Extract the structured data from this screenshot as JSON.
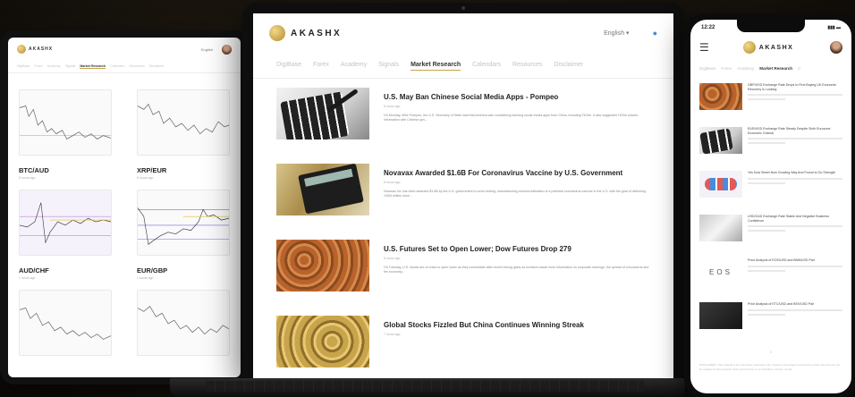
{
  "brand": {
    "name": "AKASHX",
    "language": "English",
    "accent": "#c9a44a"
  },
  "tablet": {
    "language": "English",
    "nav": [
      "DigiBase",
      "Forex",
      "Academy",
      "Signals",
      "Market Research",
      "Calendars",
      "Resources",
      "Disclaimer"
    ],
    "active_nav": "Market Research",
    "pairs": [
      {
        "name": "BTC/AUD",
        "sub": "8 hours ago"
      },
      {
        "name": "XRP/EUR",
        "sub": "8 hours ago"
      },
      {
        "name": "AUD/CHF",
        "sub": "1 hours ago"
      },
      {
        "name": "EUR/GBP",
        "sub": "1 hours ago"
      },
      {
        "name": "",
        "sub": ""
      },
      {
        "name": "",
        "sub": ""
      }
    ]
  },
  "laptop": {
    "language": "English",
    "nav": [
      "DigiBase",
      "Forex",
      "Academy",
      "Signals",
      "Market Research",
      "Calendars",
      "Resources",
      "Disclaimer"
    ],
    "active_nav": "Market Research",
    "articles": [
      {
        "title": "U.S. May Ban Chinese Social Media Apps - Pompeo",
        "time": "8 hours ago",
        "text": "On Monday, Mike Pompeo, the U.S. Secretary of State said that America was considering banning social media apps from China, including TikTok. It was suggested TikTok shared information with Chinese gov..."
      },
      {
        "title": "Novavax Awarded $1.6B For Coronavirus Vaccine by U.S. Government",
        "time": "8 hours ago",
        "text": "Novavax Inc has been awarded $1.6B by the U.S. government to cover testing, manufacturing commercialization of a potential coronavirus vaccine in the U.S. with the goal of delivering 100M million dose..."
      },
      {
        "title": "U.S. Futures Set to Open Lower; Dow Futures Drop 279",
        "time": "8 hours ago",
        "text": "On Tuesday, U.S. stocks are on track to open lower as they consolidate after recent strong gains as investors await more information on corporate earnings, the spread of coronavirus and the economy..."
      },
      {
        "title": "Global Stocks Fizzled But China Continues Winning Streak",
        "time": "7 hours ago",
        "text": ""
      }
    ]
  },
  "phone": {
    "time": "12:22",
    "nav": [
      "DigiBase",
      "Forex",
      "Academy",
      "Market Research",
      "C"
    ],
    "active_nav": "Market Research",
    "items": [
      {
        "title": "GBP/USD Exchange Rate Drops to Find Buying UK Economic Recovery is Looking"
      },
      {
        "title": "EUR/USD Exchange Rate Steady Despite Sixth Eurozone Economic Outlook"
      },
      {
        "title": "Yes Dow Street Now Growing Way And Found to Go Strength"
      },
      {
        "title": "USD/CAD Exchange Rate Stable And Negative Business Confidence"
      },
      {
        "title": "Price Analysis of EOS/USD and BNB/USD Pair"
      },
      {
        "title": "Price Analysis of ETC/USD and BSV/USD Pair"
      }
    ],
    "page": "1",
    "footer": "DISCLAIMER: This material is for information purposes only. Trading in leveraged instruments is high risk and may not be suitable for all investors. Past performance is not indicative of future results."
  }
}
